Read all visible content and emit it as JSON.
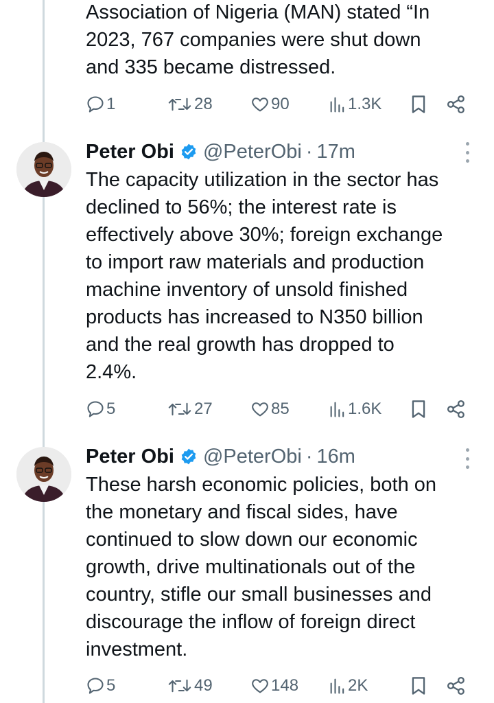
{
  "tweets": [
    {
      "text": "Association of Nigeria (MAN) stated “In\n2023, 767 companies were shut down\nand 335 became distressed.",
      "replies": "1",
      "retweets": "28",
      "likes": "90",
      "views": "1.3K"
    },
    {
      "name": "Peter Obi",
      "handle": "@PeterObi",
      "separator": "·",
      "time": "17m",
      "text": "The capacity utilization in the sector has\ndeclined to 56%; the interest rate is\neffectively above 30%; foreign exchange\nto import raw materials and production\nmachine inventory of unsold finished\nproducts has increased to N350 billion\nand the real growth has dropped to\n2.4%.",
      "replies": "5",
      "retweets": "27",
      "likes": "85",
      "views": "1.6K"
    },
    {
      "name": "Peter Obi",
      "handle": "@PeterObi",
      "separator": "·",
      "time": "16m",
      "text": "These harsh economic policies, both on\nthe monetary and fiscal sides, have\ncontinued to slow down our economic\ngrowth, drive multinationals out of the\ncountry, stifle our small businesses and\ndiscourage the inflow of foreign direct\ninvestment.",
      "replies": "5",
      "retweets": "49",
      "likes": "148",
      "views": "2K"
    }
  ],
  "colors": {
    "text": "#0f1419",
    "muted": "#536471",
    "verified": "#1d9bf0",
    "thread_line": "#cfd9de"
  }
}
